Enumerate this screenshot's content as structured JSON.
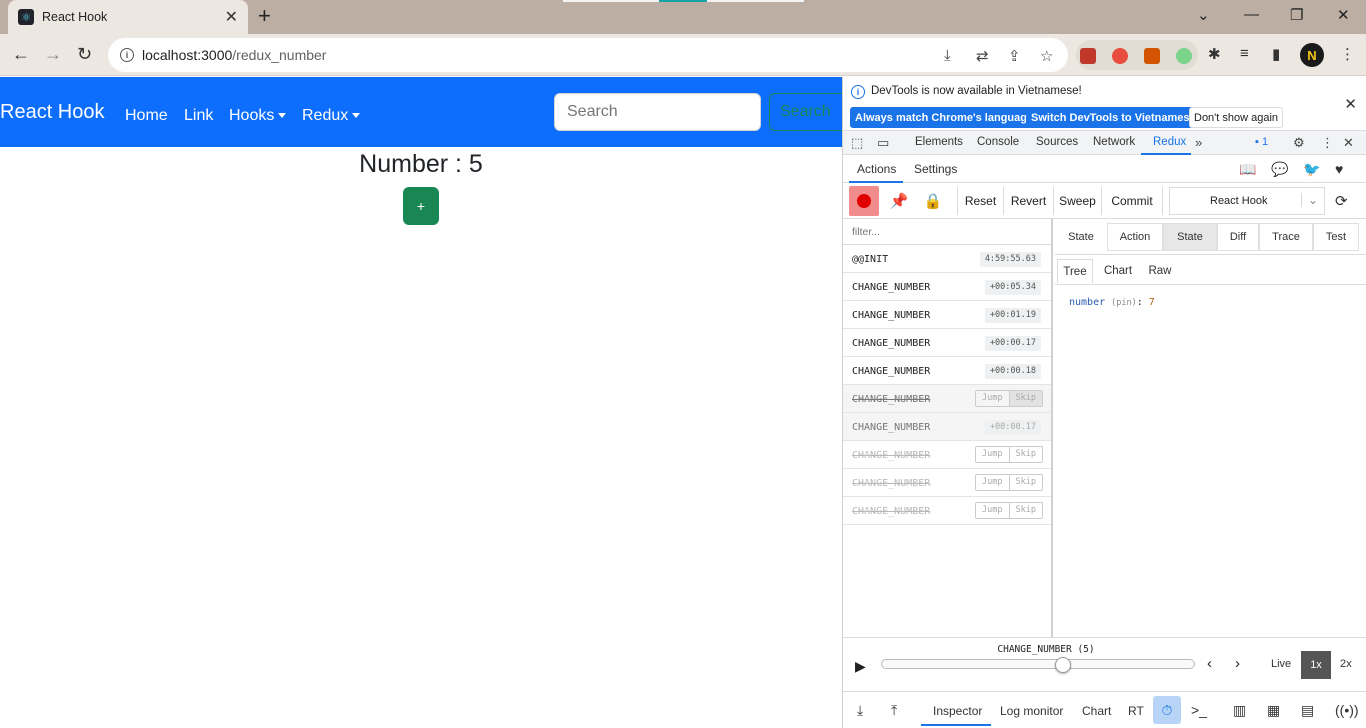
{
  "browser": {
    "tab_title": "React Hook",
    "tab_close": "✕",
    "new_tab": "+",
    "url_host": "localhost:3000",
    "url_path": "/redux_number"
  },
  "app": {
    "brand": "React Hook",
    "nav": [
      "Home",
      "Link",
      "Hooks",
      "Redux"
    ],
    "search_placeholder": "Search",
    "search_button": "Search",
    "number_text": "Number : 5",
    "plus_label": "+"
  },
  "devtools": {
    "infobar": {
      "message": "DevTools is now available in Vietnamese!",
      "btn_match": "Always match Chrome's language",
      "btn_switch": "Switch DevTools to Vietnamese",
      "btn_dismiss": "Don't show again"
    },
    "tabs": [
      "Elements",
      "Console",
      "Sources",
      "Network",
      "Redux"
    ],
    "active_tab": "Redux",
    "issues_count": "1",
    "redux": {
      "subtabs": [
        "Actions",
        "Settings"
      ],
      "toolbar_buttons": [
        "Reset",
        "Revert",
        "Sweep",
        "Commit"
      ],
      "instance": "React Hook",
      "filter_placeholder": "filter...",
      "actions": [
        {
          "name": "@@INIT",
          "time": "4:59:55.63"
        },
        {
          "name": "CHANGE_NUMBER",
          "time": "+00:05.34"
        },
        {
          "name": "CHANGE_NUMBER",
          "time": "+00:01.19"
        },
        {
          "name": "CHANGE_NUMBER",
          "time": "+00:00.17"
        },
        {
          "name": "CHANGE_NUMBER",
          "time": "+00:00.18"
        },
        {
          "name": "CHANGE_NUMBER",
          "jump": "Jump",
          "skip": "Skip"
        },
        {
          "name": "CHANGE_NUMBER",
          "time": "+00:00.17"
        },
        {
          "name": "CHANGE_NUMBER",
          "jump": "Jump",
          "skip": "Skip"
        },
        {
          "name": "CHANGE_NUMBER",
          "jump": "Jump",
          "skip": "Skip"
        },
        {
          "name": "CHANGE_NUMBER",
          "jump": "Jump",
          "skip": "Skip"
        }
      ],
      "inspector_tabs": [
        "State",
        "Action",
        "State",
        "Diff",
        "Trace",
        "Test"
      ],
      "view_tabs": [
        "Tree",
        "Chart",
        "Raw"
      ],
      "state_key": "number",
      "state_pin": "(pin)",
      "state_value": "7",
      "slider_label": "CHANGE_NUMBER (5)",
      "slider_position": 0.58,
      "live": "Live",
      "speed_1x": "1x",
      "speed_2x": "2x",
      "monitors": [
        "Inspector",
        "Log monitor",
        "Chart",
        "RT"
      ]
    }
  }
}
